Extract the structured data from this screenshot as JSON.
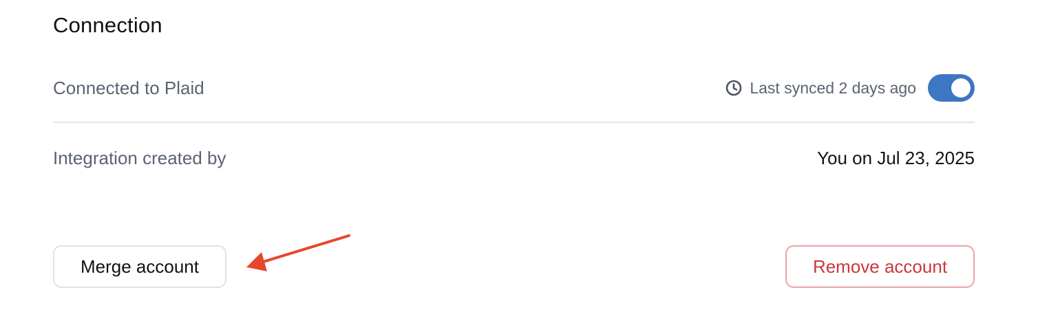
{
  "section": {
    "title": "Connection"
  },
  "connection_row": {
    "label": "Connected to Plaid",
    "sync_icon": "clock-icon",
    "sync_status": "Last synced 2 days ago",
    "sync_enabled": true
  },
  "created_row": {
    "label": "Integration created by",
    "value": "You on Jul 23, 2025"
  },
  "actions": {
    "merge_label": "Merge account",
    "remove_label": "Remove account"
  },
  "annotation": {
    "type": "arrow",
    "points_to": "merge-account-button",
    "color": "#e8452d"
  },
  "colors": {
    "toggle_on": "#3d76c2",
    "danger_text": "#c9383f",
    "danger_border": "#eaa3a8",
    "muted_text": "#5a6273"
  }
}
